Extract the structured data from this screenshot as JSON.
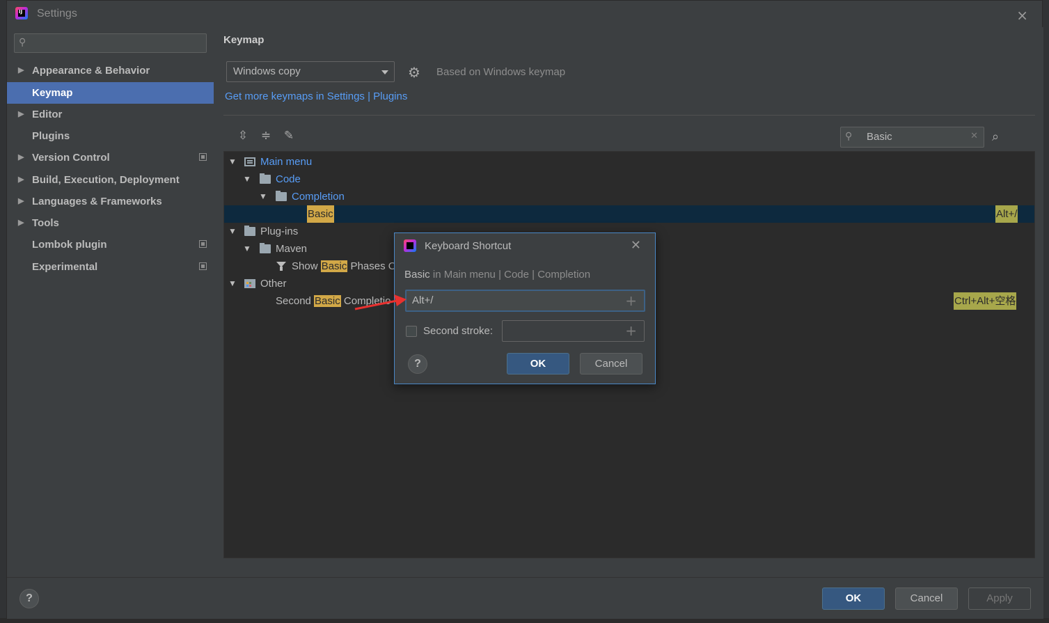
{
  "window": {
    "title": "Settings",
    "close_icon": "×"
  },
  "sidebar": {
    "search_placeholder": "",
    "items": [
      {
        "label": "Appearance & Behavior",
        "expandable": true
      },
      {
        "label": "Keymap",
        "selected": true
      },
      {
        "label": "Editor",
        "expandable": true
      },
      {
        "label": "Plugins"
      },
      {
        "label": "Version Control",
        "expandable": true,
        "project_icon": true
      },
      {
        "label": "Build, Execution, Deployment",
        "expandable": true
      },
      {
        "label": "Languages & Frameworks",
        "expandable": true
      },
      {
        "label": "Tools",
        "expandable": true
      },
      {
        "label": "Lombok plugin",
        "project_icon": true
      },
      {
        "label": "Experimental",
        "project_icon": true
      }
    ]
  },
  "keymap": {
    "section_title": "Keymap",
    "selected_keymap": "Windows copy",
    "based_on": "Based on Windows keymap",
    "more_link": "Get more keymaps in Settings | Plugins",
    "search_value": "Basic",
    "toolbar_icons": [
      "expand-all-icon",
      "collapse-all-icon",
      "edit-icon"
    ]
  },
  "tree": {
    "main_menu": "Main menu",
    "code": "Code",
    "completion": "Completion",
    "basic": "Basic",
    "basic_shortcut": "Alt+/",
    "plugins": "Plug-ins",
    "maven": "Maven",
    "show_prefix": "Show ",
    "show_hl": "Basic",
    "show_suffix": " Phases O",
    "other": "Other",
    "second_prefix": "Second ",
    "second_hl": "Basic",
    "second_suffix": " Completio",
    "second_shortcut": "Ctrl+Alt+空格"
  },
  "dialog": {
    "title": "Keyboard Shortcut",
    "path_action": "Basic",
    "path_rest": " in Main menu | Code | Completion",
    "first_stroke_value": "Alt+/",
    "second_stroke_label": "Second stroke:",
    "second_stroke_value": "",
    "ok_label": "OK",
    "cancel_label": "Cancel",
    "help_label": "?"
  },
  "footer": {
    "help_label": "?",
    "ok_label": "OK",
    "cancel_label": "Cancel",
    "apply_label": "Apply"
  },
  "colors": {
    "background": "#3c3f41",
    "selection": "#4b6eaf",
    "tree_selection": "#0d293e",
    "link": "#589df6",
    "highlight": "#d2a847",
    "primary_button": "#365880",
    "annotation_arrow": "#e8312f"
  }
}
